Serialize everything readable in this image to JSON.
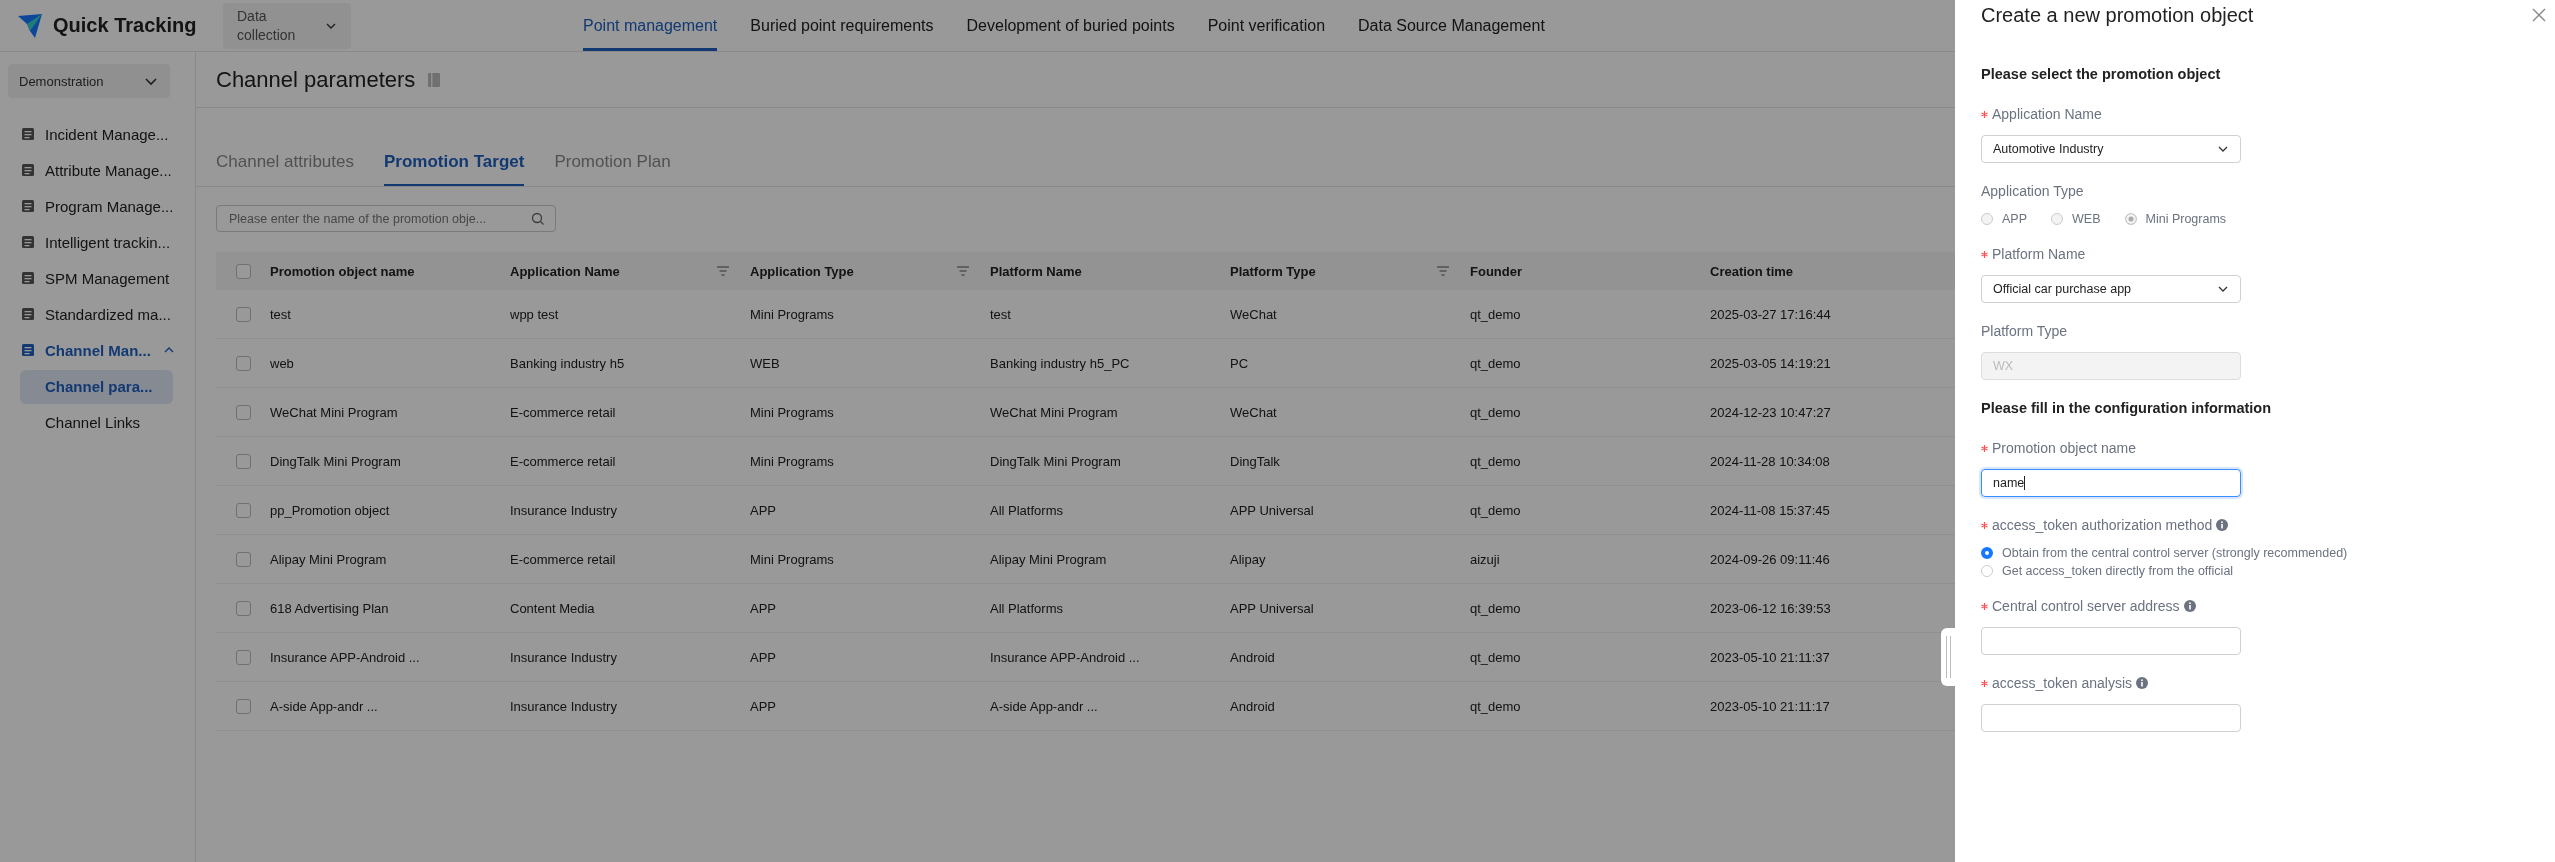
{
  "header": {
    "logo_text": "Quick Tracking",
    "workspace": "Data collection",
    "nav": [
      {
        "label": "Point management",
        "selected": true
      },
      {
        "label": "Buried point requirements",
        "selected": false
      },
      {
        "label": "Development of buried points",
        "selected": false
      },
      {
        "label": "Point verification",
        "selected": false
      },
      {
        "label": "Data Source Management",
        "selected": false
      }
    ]
  },
  "sidebar": {
    "project": "Demonstration",
    "items": [
      {
        "label": "Incident Manage...",
        "selected": false
      },
      {
        "label": "Attribute Manage...",
        "selected": false
      },
      {
        "label": "Program Manage...",
        "selected": false
      },
      {
        "label": "Intelligent trackin...",
        "selected": false
      },
      {
        "label": "SPM Management",
        "selected": false
      },
      {
        "label": "Standardized ma...",
        "selected": false
      },
      {
        "label": "Channel Man...",
        "selected": true,
        "expanded": true,
        "children": [
          {
            "label": "Channel para...",
            "selected": true
          },
          {
            "label": "Channel Links",
            "selected": false
          }
        ]
      }
    ]
  },
  "page": {
    "title": "Channel parameters",
    "tabs": [
      {
        "label": "Channel attributes",
        "selected": false
      },
      {
        "label": "Promotion Target",
        "selected": true
      },
      {
        "label": "Promotion Plan",
        "selected": false
      }
    ],
    "search": {
      "placeholder": "Please enter the name of the promotion obje..."
    },
    "table": {
      "columns": [
        {
          "label": "Promotion object name",
          "filter": false
        },
        {
          "label": "Application Name",
          "filter": true
        },
        {
          "label": "Application Type",
          "filter": true
        },
        {
          "label": "Platform Name",
          "filter": false
        },
        {
          "label": "Platform Type",
          "filter": true
        },
        {
          "label": "Founder",
          "filter": false
        },
        {
          "label": "Creation time",
          "filter": false
        }
      ],
      "select_all": {
        "checked": false
      },
      "rows": [
        {
          "checked": false,
          "cells": [
            "test",
            "wpp test",
            "Mini Programs",
            "test",
            "WeChat",
            "qt_demo",
            "2025-03-27 17:16:44"
          ]
        },
        {
          "checked": false,
          "cells": [
            "web",
            "Banking industry h5",
            "WEB",
            "Banking industry h5_PC",
            "PC",
            "qt_demo",
            "2025-03-05 14:19:21"
          ]
        },
        {
          "checked": false,
          "cells": [
            "WeChat Mini Program",
            "E-commerce retail",
            "Mini Programs",
            "WeChat Mini Program",
            "WeChat",
            "qt_demo",
            "2024-12-23 10:47:27"
          ]
        },
        {
          "checked": false,
          "cells": [
            "DingTalk Mini Program",
            "E-commerce retail",
            "Mini Programs",
            "DingTalk Mini Program",
            "DingTalk",
            "qt_demo",
            "2024-11-28 10:34:08"
          ]
        },
        {
          "checked": false,
          "cells": [
            "pp_Promotion object",
            "Insurance Industry",
            "APP",
            "All Platforms",
            "APP Universal",
            "qt_demo",
            "2024-11-08 15:37:45"
          ]
        },
        {
          "checked": false,
          "cells": [
            "Alipay Mini Program",
            "E-commerce retail",
            "Mini Programs",
            "Alipay Mini Program",
            "Alipay",
            "aizuji",
            "2024-09-26 09:11:46"
          ]
        },
        {
          "checked": false,
          "cells": [
            "618 Advertising Plan",
            "Content Media",
            "APP",
            "All Platforms",
            "APP Universal",
            "qt_demo",
            "2023-06-12 16:39:53"
          ]
        },
        {
          "checked": false,
          "cells": [
            "Insurance APP-Android ...",
            "Insurance Industry",
            "APP",
            "Insurance APP-Android ...",
            "Android",
            "qt_demo",
            "2023-05-10 21:11:37"
          ]
        },
        {
          "checked": false,
          "cells": [
            "A-side App-andr ...",
            "Insurance Industry",
            "APP",
            "A-side App-andr ...",
            "Android",
            "qt_demo",
            "2023-05-10 21:11:17"
          ]
        }
      ]
    }
  },
  "drawer": {
    "title": "Create a new promotion object",
    "sections": [
      {
        "heading": "Please select the promotion object",
        "fields": [
          {
            "kind": "select",
            "label": "Application Name",
            "required": true,
            "value": "Automotive Industry"
          },
          {
            "kind": "radio-row",
            "label": "Application Type",
            "required": false,
            "disabled": true,
            "options": [
              {
                "label": "APP",
                "selected": false
              },
              {
                "label": "WEB",
                "selected": false
              },
              {
                "label": "Mini Programs",
                "selected": true
              }
            ]
          },
          {
            "kind": "select",
            "label": "Platform Name",
            "required": true,
            "value": "Official car purchase app"
          },
          {
            "kind": "input",
            "label": "Platform Type",
            "required": false,
            "disabled": true,
            "value": "WX"
          }
        ]
      },
      {
        "heading": "Please fill in the configuration information",
        "fields": [
          {
            "kind": "input",
            "label": "Promotion object name",
            "required": true,
            "focused": true,
            "value": "name"
          },
          {
            "kind": "radio-column",
            "label": "access_token authorization method",
            "required": true,
            "info": true,
            "options": [
              {
                "label": "Obtain from the central control server (strongly recommended)",
                "selected": true
              },
              {
                "label": "Get access_token directly from the official",
                "selected": false
              }
            ]
          },
          {
            "kind": "input",
            "label": "Central control server address",
            "required": true,
            "info": true
          },
          {
            "kind": "input",
            "label": "access_token analysis",
            "required": true,
            "info": true
          }
        ]
      }
    ]
  }
}
